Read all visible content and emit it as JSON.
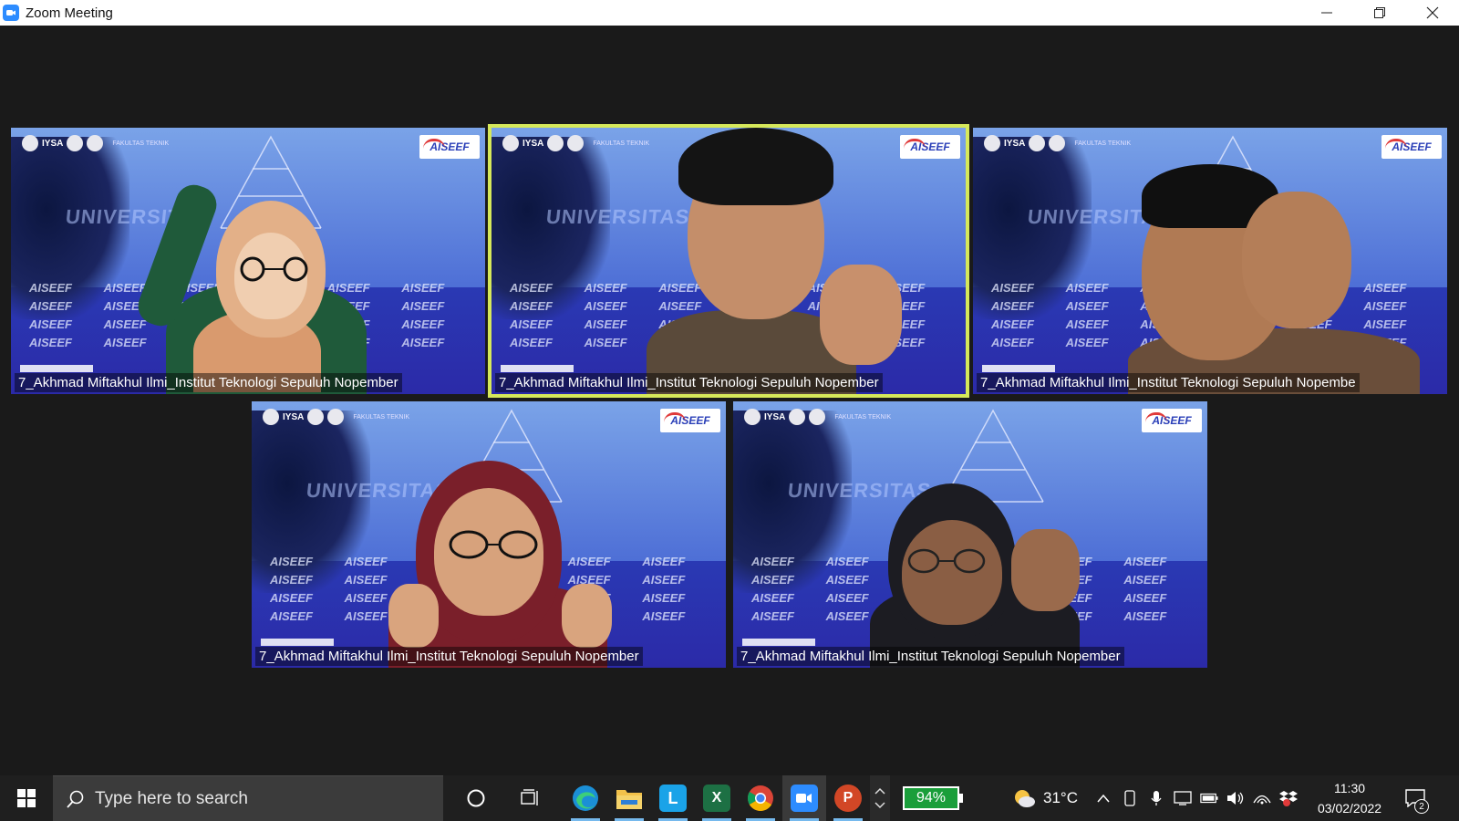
{
  "window": {
    "title": "Zoom Meeting",
    "minimize_icon": "minimize-icon",
    "restore_icon": "restore-icon",
    "close_icon": "close-icon"
  },
  "participants": [
    {
      "name": "7_Akhmad Miftakhul Ilmi_Institut Teknologi Sepuluh Nopember",
      "active_speaker": false,
      "hijab_color": "#e8b38a",
      "clothing": "#1f5a3a"
    },
    {
      "name": "7_Akhmad Miftakhul Ilmi_Institut Teknologi Sepuluh Nopember",
      "active_speaker": true,
      "hair_color": "#141414",
      "clothing": "#5a4a3a"
    },
    {
      "name": "7_Akhmad Miftakhul Ilmi_Institut Teknologi Sepuluh Nopembe",
      "active_speaker": false,
      "hair_color": "#101010",
      "clothing": "#6a4e3a"
    },
    {
      "name": "7_Akhmad Miftakhul Ilmi_Institut Teknologi Sepuluh Nopember",
      "active_speaker": false,
      "hijab_color": "#7a1f2a",
      "clothing": "#7a1f2a"
    },
    {
      "name": "7_Akhmad Miftakhul Ilmi_Institut Teknologi Sepuluh Nopember",
      "active_speaker": false,
      "hijab_color": "#1c1c22",
      "clothing": "#1c1c22"
    }
  ],
  "background": {
    "logo_text": "IYSA",
    "faculty_text": "FAKULTAS TEKNIK",
    "brand_text": "AISEEF",
    "watermark_text": "UNIVERSITAS",
    "pattern_word": "AISEEF"
  },
  "taskbar": {
    "search_placeholder": "Type here to search",
    "apps": [
      "cortana-icon",
      "task-view-icon",
      "edge-icon",
      "file-explorer-icon",
      "l-app-icon",
      "excel-icon",
      "chrome-icon",
      "zoom-icon",
      "powerpoint-icon"
    ],
    "battery_widget": "94%",
    "temperature": "31°C",
    "time": "11:30",
    "date": "03/02/2022",
    "notification_count": "2"
  },
  "colors": {
    "active_speaker_border": "#d6e85a",
    "zoom_blue": "#2d8cff",
    "taskbar_bg": "#1f1f1f",
    "meeting_bg": "#1a1a1a"
  }
}
